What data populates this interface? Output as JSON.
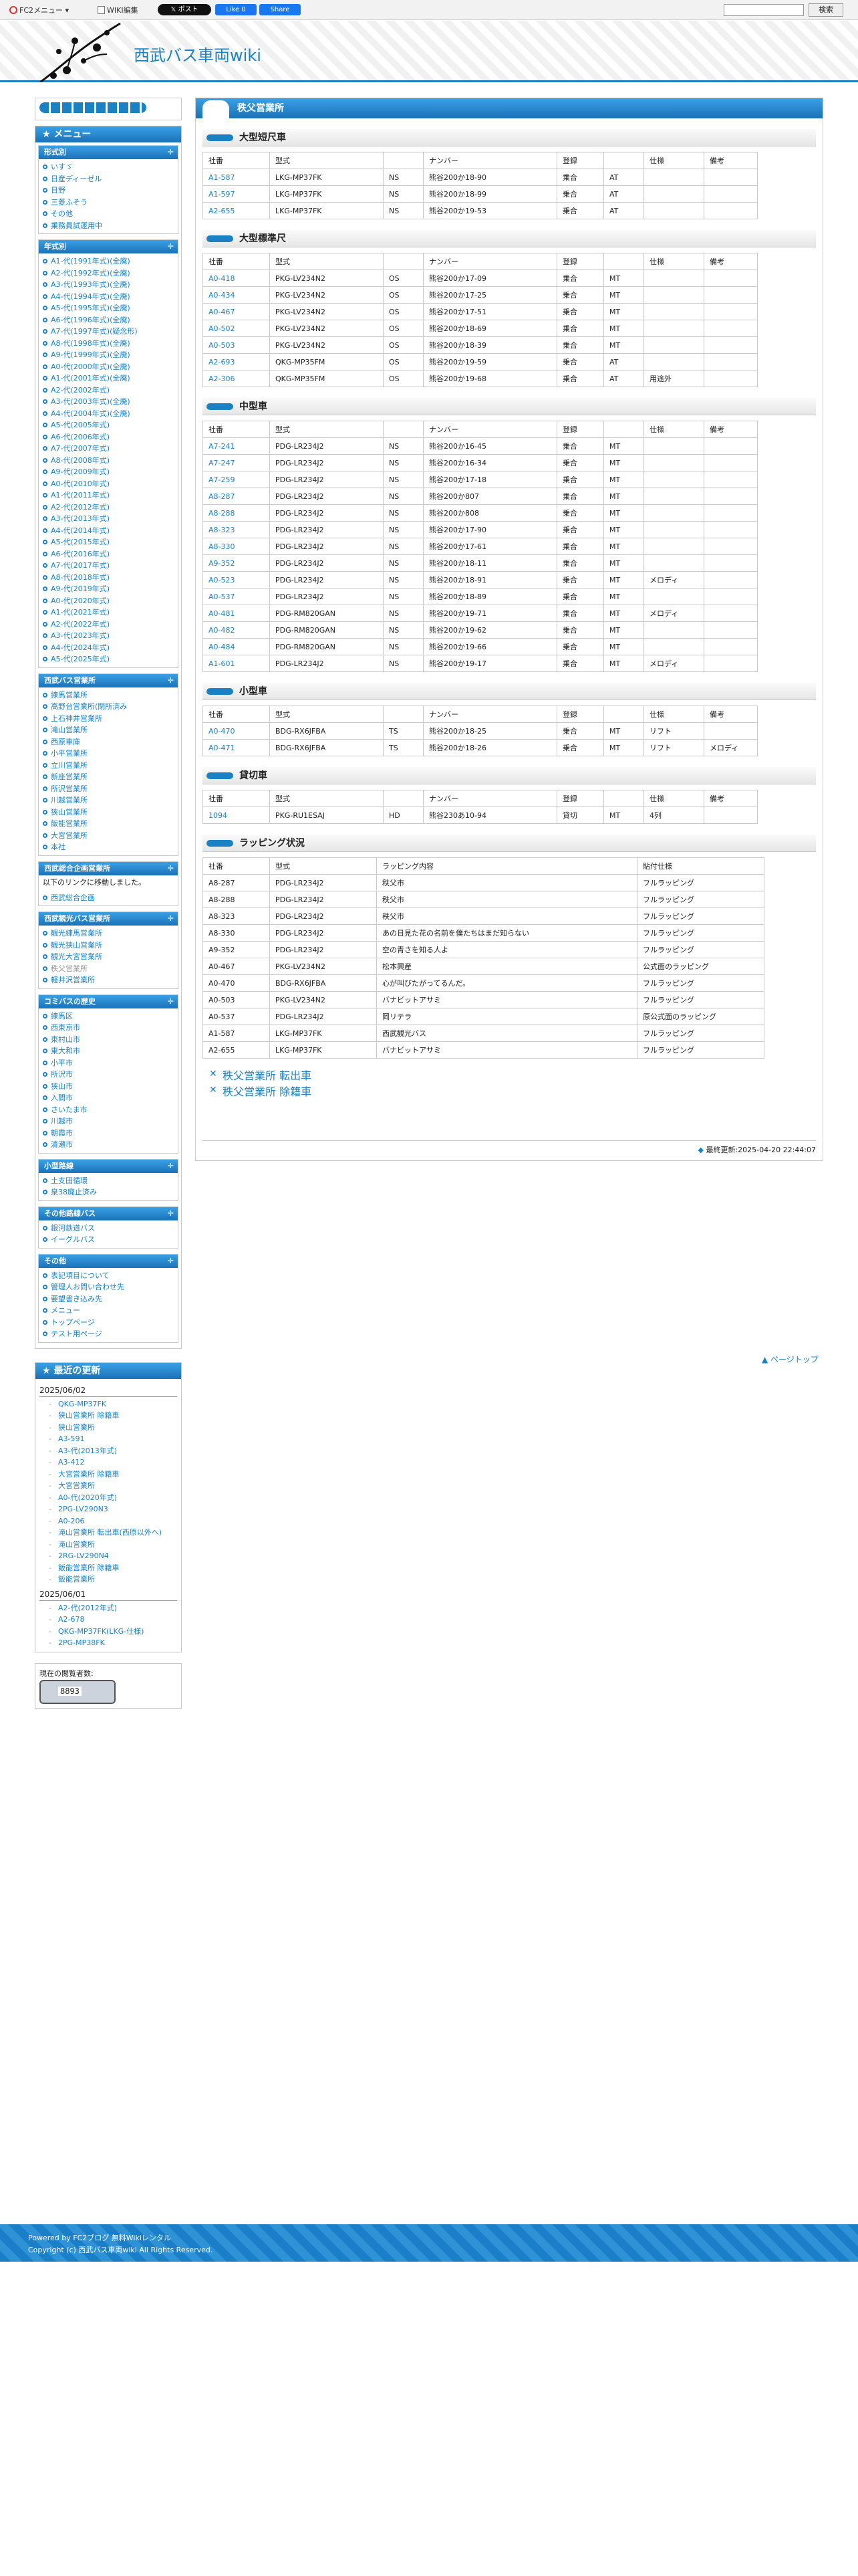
{
  "topbar": {
    "fc2_menu": "FC2メニュー",
    "wiki_edit": "WIKI編集",
    "x_post": "ポスト",
    "fb_like": "Like 0",
    "fb_share": "Share",
    "search_button": "検索"
  },
  "site": {
    "title": "西武バス車両wiki"
  },
  "page": {
    "title": "秩父営業所",
    "last_modified": "最終更新:2025-04-20 22:44:07",
    "pagetop": "ページトップ"
  },
  "tables": [
    {
      "heading": "大型短尺車",
      "columns": [
        "社番",
        "型式",
        "",
        "ナンバー",
        "登録",
        "",
        "仕様",
        "備考"
      ],
      "rows": [
        [
          "A1-587",
          "LKG-MP37FK",
          "NS",
          "熊谷200か18-90",
          "乗合",
          "AT",
          "",
          ""
        ],
        [
          "A1-597",
          "LKG-MP37FK",
          "NS",
          "熊谷200か18-99",
          "乗合",
          "AT",
          "",
          ""
        ],
        [
          "A2-655",
          "LKG-MP37FK",
          "NS",
          "熊谷200か19-53",
          "乗合",
          "AT",
          "",
          ""
        ]
      ]
    },
    {
      "heading": "大型標準尺",
      "columns": [
        "社番",
        "型式",
        "",
        "ナンバー",
        "登録",
        "",
        "仕様",
        "備考"
      ],
      "rows": [
        [
          "A0-418",
          "PKG-LV234N2",
          "OS",
          "熊谷200か17-09",
          "乗合",
          "MT",
          "",
          ""
        ],
        [
          "A0-434",
          "PKG-LV234N2",
          "OS",
          "熊谷200か17-25",
          "乗合",
          "MT",
          "",
          ""
        ],
        [
          "A0-467",
          "PKG-LV234N2",
          "OS",
          "熊谷200か17-51",
          "乗合",
          "MT",
          "",
          ""
        ],
        [
          "A0-502",
          "PKG-LV234N2",
          "OS",
          "熊谷200か18-69",
          "乗合",
          "MT",
          "",
          ""
        ],
        [
          "A0-503",
          "PKG-LV234N2",
          "OS",
          "熊谷200か18-39",
          "乗合",
          "MT",
          "",
          ""
        ],
        [
          "A2-693",
          "QKG-MP35FM",
          "OS",
          "熊谷200か19-59",
          "乗合",
          "AT",
          "",
          ""
        ],
        [
          "A2-306",
          "QKG-MP35FM",
          "OS",
          "熊谷200か19-68",
          "乗合",
          "AT",
          "用途外",
          ""
        ]
      ]
    },
    {
      "heading": "中型車",
      "columns": [
        "社番",
        "型式",
        "",
        "ナンバー",
        "登録",
        "",
        "仕様",
        "備考"
      ],
      "rows": [
        [
          "A7-241",
          "PDG-LR234J2",
          "NS",
          "熊谷200か16-45",
          "乗合",
          "MT",
          "",
          ""
        ],
        [
          "A7-247",
          "PDG-LR234J2",
          "NS",
          "熊谷200か16-34",
          "乗合",
          "MT",
          "",
          ""
        ],
        [
          "A7-259",
          "PDG-LR234J2",
          "NS",
          "熊谷200か17-18",
          "乗合",
          "MT",
          "",
          ""
        ],
        [
          "A8-287",
          "PDG-LR234J2",
          "NS",
          "熊谷200か807",
          "乗合",
          "MT",
          "",
          ""
        ],
        [
          "A8-288",
          "PDG-LR234J2",
          "NS",
          "熊谷200か808",
          "乗合",
          "MT",
          "",
          ""
        ],
        [
          "A8-323",
          "PDG-LR234J2",
          "NS",
          "熊谷200か17-90",
          "乗合",
          "MT",
          "",
          ""
        ],
        [
          "A8-330",
          "PDG-LR234J2",
          "NS",
          "熊谷200か17-61",
          "乗合",
          "MT",
          "",
          ""
        ],
        [
          "A9-352",
          "PDG-LR234J2",
          "NS",
          "熊谷200か18-11",
          "乗合",
          "MT",
          "",
          ""
        ],
        [
          "A0-523",
          "PDG-LR234J2",
          "NS",
          "熊谷200か18-91",
          "乗合",
          "MT",
          "メロディ",
          ""
        ],
        [
          "A0-537",
          "PDG-LR234J2",
          "NS",
          "熊谷200か18-89",
          "乗合",
          "MT",
          "",
          ""
        ],
        [
          "A0-481",
          "PDG-RM820GAN",
          "NS",
          "熊谷200か19-71",
          "乗合",
          "MT",
          "メロディ",
          ""
        ],
        [
          "A0-482",
          "PDG-RM820GAN",
          "NS",
          "熊谷200か19-62",
          "乗合",
          "MT",
          "",
          ""
        ],
        [
          "A0-484",
          "PDG-RM820GAN",
          "NS",
          "熊谷200か19-66",
          "乗合",
          "MT",
          "",
          ""
        ],
        [
          "A1-601",
          "PDG-LR234J2",
          "NS",
          "熊谷200か19-17",
          "乗合",
          "MT",
          "メロディ",
          ""
        ]
      ]
    },
    {
      "heading": "小型車",
      "columns": [
        "社番",
        "型式",
        "",
        "ナンバー",
        "登録",
        "",
        "仕様",
        "備考"
      ],
      "rows": [
        [
          "A0-470",
          "BDG-RX6JFBA",
          "TS",
          "熊谷200か18-25",
          "乗合",
          "MT",
          "リフト",
          ""
        ],
        [
          "A0-471",
          "BDG-RX6JFBA",
          "TS",
          "熊谷200か18-26",
          "乗合",
          "MT",
          "リフト",
          "メロディ"
        ]
      ]
    },
    {
      "heading": "貸切車",
      "columns": [
        "社番",
        "型式",
        "",
        "ナンバー",
        "登録",
        "",
        "仕様",
        "備考"
      ],
      "rows": [
        [
          "1094",
          "PKG-RU1ESAJ",
          "HD",
          "熊谷230あ10-94",
          "貸切",
          "MT",
          "4列",
          ""
        ]
      ]
    }
  ],
  "wrapping": {
    "heading": "ラッピング状況",
    "columns": [
      "社番",
      "型式",
      "ラッピング内容",
      "貼付仕様"
    ],
    "rows": [
      [
        "A8-287",
        "PDG-LR234J2",
        "秩父市",
        "フルラッピング"
      ],
      [
        "A8-288",
        "PDG-LR234J2",
        "秩父市",
        "フルラッピング"
      ],
      [
        "A8-323",
        "PDG-LR234J2",
        "秩父市",
        "フルラッピング"
      ],
      [
        "A8-330",
        "PDG-LR234J2",
        "あの日見た花の名前を僕たちはまだ知らない",
        "フルラッピング"
      ],
      [
        "A9-352",
        "PDG-LR234J2",
        "空の青さを知る人よ",
        "フルラッピング"
      ],
      [
        "A0-467",
        "PKG-LV234N2",
        "松本興産",
        "公式面のラッピング"
      ],
      [
        "A0-470",
        "BDG-RX6JFBA",
        "心が叫びたがってるんだ。",
        "フルラッピング"
      ],
      [
        "A0-503",
        "PKG-LV234N2",
        "バナビットアサミ",
        "フルラッピング"
      ],
      [
        "A0-537",
        "PDG-LR234J2",
        "岡リテラ",
        "原公式面のラッピング"
      ],
      [
        "A1-587",
        "LKG-MP37FK",
        "西武観光バス",
        "フルラッピング"
      ],
      [
        "A2-655",
        "LKG-MP37FK",
        "バナビットアサミ",
        "フルラッピング"
      ]
    ]
  },
  "bottom_links": [
    "秩父営業所 転出車",
    "秩父営業所 除籍車"
  ],
  "sidebar": {
    "menu_title": "メニュー",
    "groups": [
      {
        "title": "形式別",
        "items": [
          {
            "t": "いすゞ"
          },
          {
            "t": "日産ディーゼル"
          },
          {
            "t": "日野"
          },
          {
            "t": "三菱ふそう"
          },
          {
            "t": "その他"
          },
          {
            "t": "乗務員試運用中"
          }
        ]
      },
      {
        "title": "年式別",
        "items": [
          {
            "t": "A1-代(1991年式)(全廃)"
          },
          {
            "t": "A2-代(1992年式)(全廃)"
          },
          {
            "t": "A3-代(1993年式)(全廃)"
          },
          {
            "t": "A4-代(1994年式)(全廃)"
          },
          {
            "t": "A5-代(1995年式)(全廃)"
          },
          {
            "t": "A6-代(1996年式)(全廃)"
          },
          {
            "t": "A7-代(1997年式)(疑念形)"
          },
          {
            "t": "A8-代(1998年式)(全廃)"
          },
          {
            "t": "A9-代(1999年式)(全廃)"
          },
          {
            "t": "A0-代(2000年式)(全廃)"
          },
          {
            "t": "A1-代(2001年式)(全廃)"
          },
          {
            "t": "A2-代(2002年式)"
          },
          {
            "t": "A3-代(2003年式)(全廃)"
          },
          {
            "t": "A4-代(2004年式)(全廃)"
          },
          {
            "t": "A5-代(2005年式)"
          },
          {
            "t": "A6-代(2006年式)"
          },
          {
            "t": "A7-代(2007年式)"
          },
          {
            "t": "A8-代(2008年式)"
          },
          {
            "t": "A9-代(2009年式)"
          },
          {
            "t": "A0-代(2010年式)"
          },
          {
            "t": "A1-代(2011年式)"
          },
          {
            "t": "A2-代(2012年式)"
          },
          {
            "t": "A3-代(2013年式)"
          },
          {
            "t": "A4-代(2014年式)"
          },
          {
            "t": "A5-代(2015年式)"
          },
          {
            "t": "A6-代(2016年式)"
          },
          {
            "t": "A7-代(2017年式)"
          },
          {
            "t": "A8-代(2018年式)"
          },
          {
            "t": "A9-代(2019年式)"
          },
          {
            "t": "A0-代(2020年式)"
          },
          {
            "t": "A1-代(2021年式)"
          },
          {
            "t": "A2-代(2022年式)"
          },
          {
            "t": "A3-代(2023年式)"
          },
          {
            "t": "A4-代(2024年式)"
          },
          {
            "t": "A5-代(2025年式)"
          }
        ]
      },
      {
        "title": "西武バス営業所",
        "items": [
          {
            "t": "練馬営業所"
          },
          {
            "t": "高野台営業所(閉所済み"
          },
          {
            "t": "上石神井営業所"
          },
          {
            "t": "滝山営業所"
          },
          {
            "t": "西原車庫"
          },
          {
            "t": "小平営業所"
          },
          {
            "t": "立川営業所"
          },
          {
            "t": "新座営業所"
          },
          {
            "t": "所沢営業所"
          },
          {
            "t": "川越営業所"
          },
          {
            "t": "狭山営業所"
          },
          {
            "t": "飯能営業所"
          },
          {
            "t": "大宮営業所"
          },
          {
            "t": "本社"
          }
        ]
      },
      {
        "title": "西武総合企画営業所",
        "text": "以下のリンクに移動しました。",
        "items": [
          {
            "t": "西武総合企画"
          }
        ]
      },
      {
        "title": "西武観光バス営業所",
        "items": [
          {
            "t": "観光練馬営業所"
          },
          {
            "t": "観光狭山営業所"
          },
          {
            "t": "観光大宮営業所"
          },
          {
            "t": "秩父営業所",
            "gray": true
          },
          {
            "t": "軽井沢営業所"
          }
        ]
      },
      {
        "title": "コミバスの歴史",
        "items": [
          {
            "t": "練馬区"
          },
          {
            "t": "西東京市"
          },
          {
            "t": "東村山市"
          },
          {
            "t": "東大和市"
          },
          {
            "t": "小平市"
          },
          {
            "t": "所沢市"
          },
          {
            "t": "狭山市"
          },
          {
            "t": "入間市"
          },
          {
            "t": "さいたま市"
          },
          {
            "t": "川越市"
          },
          {
            "t": "朝霞市"
          },
          {
            "t": "清瀬市"
          }
        ]
      },
      {
        "title": "小型路線",
        "items": [
          {
            "t": "土支田循環"
          },
          {
            "t": "泉38廃止済み"
          }
        ]
      },
      {
        "title": "その他路線バス",
        "items": [
          {
            "t": "銀河鉄道バス"
          },
          {
            "t": "イーグルバス"
          }
        ]
      },
      {
        "title": "その他",
        "items": [
          {
            "t": "表記項目について"
          },
          {
            "t": "管理人お問い合わせ先"
          },
          {
            "t": "要望書き込み先"
          },
          {
            "t": "メニュー"
          },
          {
            "t": "トップページ"
          },
          {
            "t": "テスト用ページ"
          }
        ]
      }
    ],
    "recent_title": "最近の更新",
    "recent": [
      {
        "date": "2025/06/02",
        "items": [
          "QKG-MP37FK",
          "狭山営業所 除籍車",
          "狭山営業所",
          "A3-591",
          "A3-代(2013年式)",
          "A3-412",
          "大宮営業所 除籍車",
          "大宮営業所",
          "A0-代(2020年式)",
          "2PG-LV290N3",
          "A0-206",
          "滝山営業所 転出車(西原以外へ)",
          "滝山営業所",
          "2RG-LV290N4",
          "飯能営業所 除籍車",
          "飯能営業所"
        ]
      },
      {
        "date": "2025/06/01",
        "items": [
          "A2-代(2012年式)",
          "A2-678",
          "QKG-MP37FK(LKG-仕様)",
          "2PG-MP38FK"
        ]
      }
    ],
    "counter_label": "現在の閲覧者数:",
    "counter_value": "8893"
  },
  "footer": {
    "line1": "Powered by FC2ブログ 無料Wikiレンタル",
    "line2": "Copyright (c) 西武バス車両wiki All Rights Reserved."
  }
}
